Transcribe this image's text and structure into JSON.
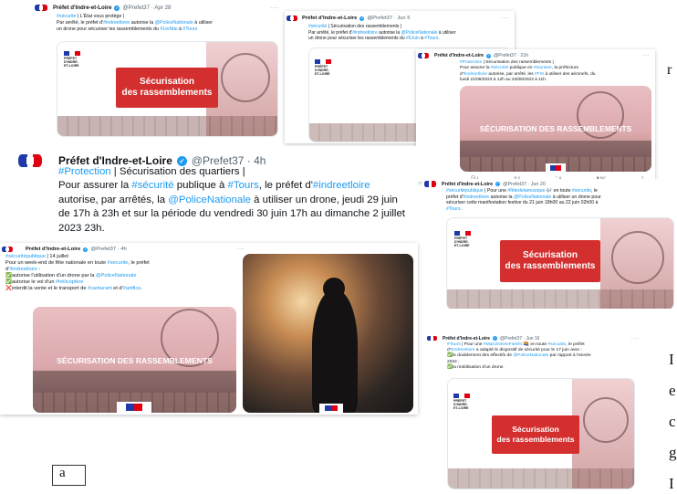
{
  "figure_label": "a",
  "side_fragments": [
    "r",
    "I",
    "e",
    "c",
    "g",
    "I"
  ],
  "tweets": [
    {
      "account": "Préfet d'Indre-et-Loire",
      "handle": "@Prefet37 · Apr 28",
      "segments": [
        {
          "t": "#sécurité",
          "h": true
        },
        {
          "t": " | L'État vous protège |\nPar arrêté, le préfet d'",
          "h": false
        },
        {
          "t": "#indreetloire",
          "h": true
        },
        {
          "t": " autorise la ",
          "h": false
        },
        {
          "t": "@PoliceNationale",
          "h": true
        },
        {
          "t": " à utiliser\nun drone pour sécuriser les rassemblements du ",
          "h": false
        },
        {
          "t": "#1erMai",
          "h": true
        },
        {
          "t": " à ",
          "h": false
        },
        {
          "t": "#Tours",
          "h": true
        }
      ],
      "card_title": "Sécurisation\ndes rassemblements",
      "card_logo": "PRÉFET\nD'INDRE-\nET-LOIRE"
    },
    {
      "account": "Préfet d'Indre-et-Loire",
      "handle": "@Prefet37 · Jun 5",
      "segments": [
        {
          "t": "#sécurité",
          "h": true
        },
        {
          "t": " | Sécurisation des rassemblements |\nPar arrêté, le préfet d'",
          "h": false
        },
        {
          "t": "#indreetloire",
          "h": true
        },
        {
          "t": " autorise la ",
          "h": false
        },
        {
          "t": "@PoliceNationale",
          "h": true
        },
        {
          "t": " à utiliser\nun drone pour sécuriser les rassemblements du ",
          "h": false
        },
        {
          "t": "#6Juin",
          "h": true
        },
        {
          "t": " à ",
          "h": false
        },
        {
          "t": "#Tours",
          "h": true
        },
        {
          "t": ".",
          "h": false
        }
      ],
      "card_title": "Sécurisation\ndes rassemblements",
      "card_logo": "PRÉFET\nD'INDRE-\nET-LOIRE"
    },
    {
      "account": "Préfet d'Indre-et-Loire",
      "handle": "@Prefet37 · 21h",
      "segments": [
        {
          "t": "#Protection",
          "h": true
        },
        {
          "t": " | Sécurisation des rassemblements |\nPour assurer la ",
          "h": false
        },
        {
          "t": "#sécurité",
          "h": true
        },
        {
          "t": " publique en ",
          "h": false
        },
        {
          "t": "#touraine",
          "h": true
        },
        {
          "t": ", la préfecture\nd'",
          "h": false
        },
        {
          "t": "#indreetloire",
          "h": true
        },
        {
          "t": " autorise, par arrêté, les ",
          "h": false
        },
        {
          "t": "#FSI",
          "h": true
        },
        {
          "t": " à utiliser des aéronefs, du\nlundi 21/08/2023 à 12h au 23/08/2023 à 11h.",
          "h": false
        }
      ],
      "card_title": "SÉCURISATION DES RASSEMBLEMENTS",
      "actions": [
        "1",
        "3",
        "6",
        "967",
        ""
      ]
    },
    {
      "account": "Préfet d'Indre-et-Loire",
      "handle": "@Prefet37 · 4h",
      "segments": [
        {
          "t": "#Protection",
          "h": true
        },
        {
          "t": " | Sécurisation des quartiers |\nPour assurer la ",
          "h": false
        },
        {
          "t": "#sécurité",
          "h": true
        },
        {
          "t": " publique à ",
          "h": false
        },
        {
          "t": "#Tours",
          "h": true
        },
        {
          "t": ", le préfet d'",
          "h": false
        },
        {
          "t": "#indreetloire",
          "h": true
        },
        {
          "t": "\nautorise, par arrêtés, la ",
          "h": false
        },
        {
          "t": "@PoliceNationale",
          "h": true
        },
        {
          "t": " à utiliser un drone, jeudi 29 juin\nde 17h à 23h et sur la période du vendredi 30 juin 17h au dimanche 2 juillet\n2023 23h.",
          "h": false
        }
      ]
    },
    {
      "account": "Préfet d'Indre-et-Loire",
      "handle": "@Prefet37 · Jun 20",
      "segments": [
        {
          "t": "#sécuritépublique",
          "h": true
        },
        {
          "t": " | Pour une ",
          "h": false
        },
        {
          "t": "#fêtedelamusique",
          "h": true
        },
        {
          "t": " 🎶 en toute ",
          "h": false
        },
        {
          "t": "#securite",
          "h": true
        },
        {
          "t": ", le\npréfet d'",
          "h": false
        },
        {
          "t": "#indreetloire",
          "h": true
        },
        {
          "t": " autorise la ",
          "h": false
        },
        {
          "t": "@PoliceNationale",
          "h": true
        },
        {
          "t": " à utiliser un drone pour\nsécuriser cette manifestation festive du 21 juin 18h00 au 22 juin 02h00 à\n",
          "h": false
        },
        {
          "t": "#Tours",
          "h": true
        },
        {
          "t": ".",
          "h": false
        }
      ],
      "card_title": "Sécurisation\ndes rassemblements",
      "card_logo": "PRÉFET\nD'INDRE-\nET-LOIRE"
    },
    {
      "account": "Préfet d'Indre-et-Loire",
      "handle": "@Prefet37 · 4h",
      "segments": [
        {
          "t": "#sécuritépublique",
          "h": true
        },
        {
          "t": " | 14 juillet\nPour un week-end de fête nationale en toute ",
          "h": false
        },
        {
          "t": "#securite",
          "h": true
        },
        {
          "t": ", le préfet\nd'",
          "h": false
        },
        {
          "t": "#indreetloire",
          "h": true
        },
        {
          "t": " :\n✅autorise l'utilisation d'un drone par la ",
          "h": false
        },
        {
          "t": "@PoliceNationale",
          "h": true
        },
        {
          "t": "\n✅autorise le vol d'un ",
          "h": false
        },
        {
          "t": "#hélicoptère",
          "h": true
        },
        {
          "t": "\n❌interdit la vente et le transport de ",
          "h": false
        },
        {
          "t": "#carburant",
          "h": true
        },
        {
          "t": " et d'",
          "h": false
        },
        {
          "t": "#artifice",
          "h": true
        },
        {
          "t": ".",
          "h": false
        }
      ],
      "card_title": "SÉCURISATION DES RASSEMBLEMENTS"
    },
    {
      "account": "Préfet d'Indre-et-Loire",
      "handle": "@Prefet37 · Jun 16",
      "segments": [
        {
          "t": "#Tours",
          "h": true
        },
        {
          "t": " | Pour une ",
          "h": false
        },
        {
          "t": "#MarcheDesFiertés",
          "h": true
        },
        {
          "t": " 🏳️‍🌈 en toute ",
          "h": false
        },
        {
          "t": "#securite",
          "h": true
        },
        {
          "t": ", le préfet\nd'",
          "h": false
        },
        {
          "t": "#indreetloire",
          "h": true
        },
        {
          "t": " a adapté le dispositif de sécurité pour le 17 juin avec :\n✅le doublement des effectifs de ",
          "h": false
        },
        {
          "t": "@PoliceNationale",
          "h": true
        },
        {
          "t": " par rapport à l'année\n2022 ;\n✅la mobilisation d'un drone.",
          "h": false
        }
      ],
      "card_title": "Sécurisation\ndes rassemblements",
      "card_logo": "PRÉFET\nD'INDRE-\nET-LOIRE"
    }
  ]
}
